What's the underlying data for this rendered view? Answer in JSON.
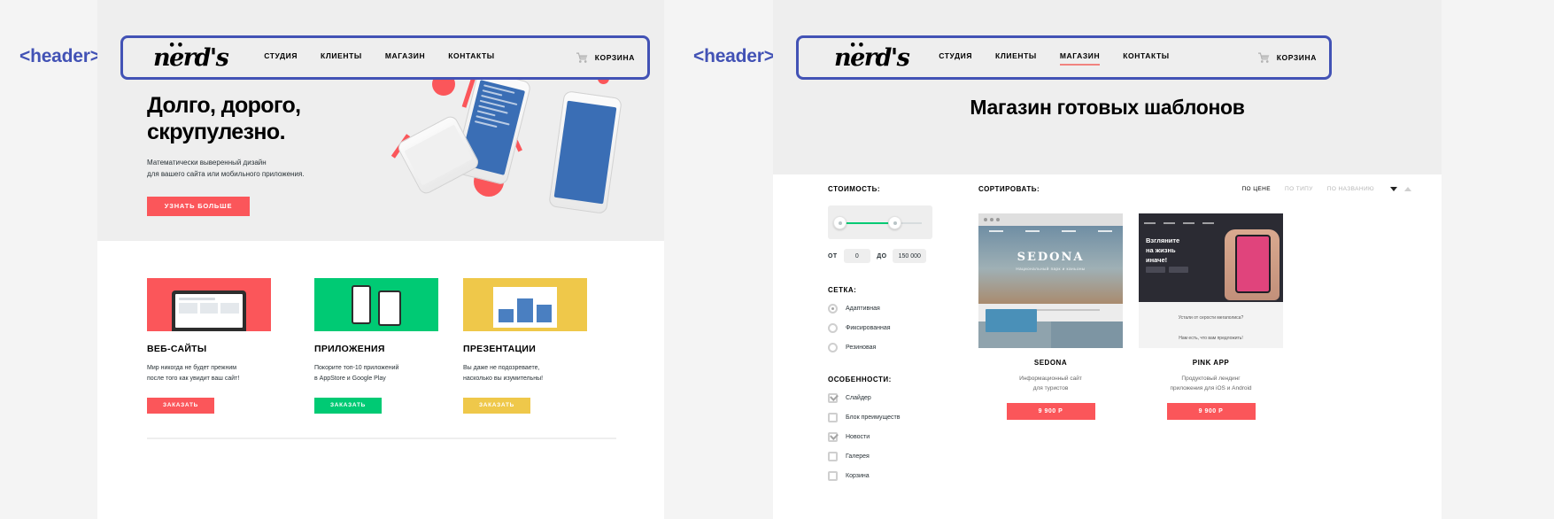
{
  "annotations": {
    "left": "<header>",
    "right": "<header>"
  },
  "brand": {
    "logo": "nerd's",
    "accent_red": "#fb565a",
    "accent_green": "#00ca74",
    "accent_yellow": "#efc84a",
    "annotation_blue": "#4252b5"
  },
  "left_panel": {
    "nav": {
      "items": [
        "СТУДИЯ",
        "КЛИЕНТЫ",
        "МАГАЗИН",
        "КОНТАКТЫ"
      ],
      "cart_label": "КОРЗИНА",
      "cart_icon": "cart-icon"
    },
    "hero": {
      "heading_line1": "Долго, дорого,",
      "heading_line2": "скрупулезно.",
      "sub_line1": "Математически выверенный дизайн",
      "sub_line2": "для вашего сайта или мобильного приложения.",
      "cta": "УЗНАТЬ БОЛЬШЕ"
    },
    "services": [
      {
        "title": "ВЕБ-САЙТЫ",
        "desc_line1": "Мир никогда не будет прежним",
        "desc_line2": "после того как увидит ваш сайт!",
        "button": "ЗАКАЗАТЬ"
      },
      {
        "title": "ПРИЛОЖЕНИЯ",
        "desc_line1": "Покорите топ-10 приложений",
        "desc_line2": "в AppStore и Google Play",
        "button": "ЗАКАЗАТЬ"
      },
      {
        "title": "ПРЕЗЕНТАЦИИ",
        "desc_line1": "Вы даже не подозреваете,",
        "desc_line2": "насколько вы изумительны!",
        "button": "ЗАКАЗАТЬ"
      }
    ]
  },
  "right_panel": {
    "nav": {
      "items": [
        "СТУДИЯ",
        "КЛИЕНТЫ",
        "МАГАЗИН",
        "КОНТАКТЫ"
      ],
      "active": "МАГАЗИН",
      "cart_label": "КОРЗИНА",
      "cart_icon": "cart-icon"
    },
    "title": "Магазин готовых шаблонов",
    "filters": {
      "price_label": "СТОИМОСТЬ:",
      "range_from_label": "ОТ",
      "range_to_label": "ДО",
      "range_min": "0",
      "range_max": "150 000",
      "grid_label": "СЕТКА:",
      "grid_options": [
        {
          "label": "Адаптивная",
          "checked": true
        },
        {
          "label": "Фиксированная",
          "checked": false
        },
        {
          "label": "Резиновая",
          "checked": false
        }
      ],
      "features_label": "ОСОБЕННОСТИ:",
      "feature_options": [
        {
          "label": "Слайдер",
          "checked": true
        },
        {
          "label": "Блок преимуществ",
          "checked": false
        },
        {
          "label": "Новости",
          "checked": true
        },
        {
          "label": "Галерея",
          "checked": false
        },
        {
          "label": "Корзина",
          "checked": false
        }
      ]
    },
    "sort": {
      "label": "СОРТИРОВАТЬ:",
      "options": [
        {
          "label": "ПО ЦЕНЕ",
          "active": true
        },
        {
          "label": "ПО ТИПУ",
          "active": false
        },
        {
          "label": "ПО НАЗВАНИЮ",
          "active": false
        }
      ]
    },
    "products": [
      {
        "name": "SEDONA",
        "desc_line1": "Информационный сайт",
        "desc_line2": "для туристов",
        "price": "9 900 Р",
        "shot_word": "SEDONA",
        "shot_sub": "Национальный парк и каньоны"
      },
      {
        "name": "PINK APP",
        "desc_line1": "Продуктовый лендинг",
        "desc_line2": "приложения для iOS и Android",
        "price": "9 900 Р",
        "shot_heading_1": "Взгляните",
        "shot_heading_2": "на жизнь",
        "shot_heading_3": "иначе!",
        "shot_foot_1": "Устали от серости мегаполиса?",
        "shot_foot_2": "Нам есть, что вам предложить!"
      }
    ]
  }
}
